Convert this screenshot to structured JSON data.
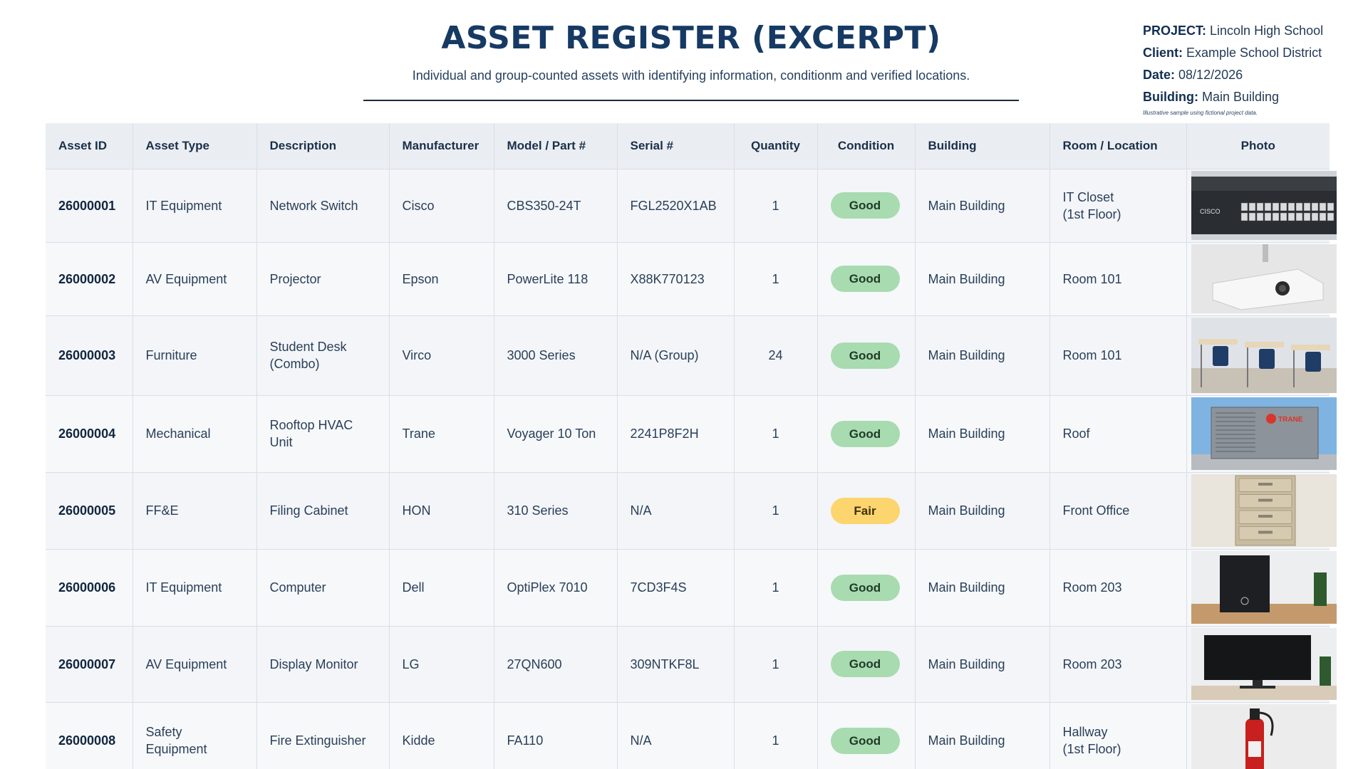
{
  "header": {
    "title": "ASSET REGISTER (EXCERPT)",
    "subtitle": "Individual and group-counted assets with identifying information, conditionm and verified locations."
  },
  "meta": {
    "project_label": "PROJECT:",
    "project": "Lincoln High School",
    "client_label": "Client:",
    "client": "Example School District",
    "date_label": "Date:",
    "date": "08/12/2026",
    "building_label": "Building:",
    "building": "Main Building",
    "note": "Illustrative sample using fictional project data."
  },
  "table": {
    "columns": [
      "Asset ID",
      "Asset Type",
      "Description",
      "Manufacturer",
      "Model / Part #",
      "Serial #",
      "Quantity",
      "Condition",
      "Building",
      "Room / Location",
      "Photo"
    ],
    "rows": [
      {
        "id": "26000001",
        "type": "IT Equipment",
        "desc": "Network Switch",
        "mfr": "Cisco",
        "model": "CBS350-24T",
        "serial": "FGL2520X1AB",
        "qty": "1",
        "cond": "Good",
        "bldg": "Main Building",
        "loc": "IT Closet\n(1st Floor)",
        "photo": "network-switch-photo",
        "logo": "CISCO"
      },
      {
        "id": "26000002",
        "type": "AV Equipment",
        "desc": "Projector",
        "mfr": "Epson",
        "model": "PowerLite 118",
        "serial": "X88K770123",
        "qty": "1",
        "cond": "Good",
        "bldg": "Main Building",
        "loc": "Room 101",
        "photo": "projector-photo"
      },
      {
        "id": "26000003",
        "type": "Furniture",
        "desc": "Student Desk\n(Combo)",
        "mfr": "Virco",
        "model": "3000 Series",
        "serial": "N/A (Group)",
        "qty": "24",
        "cond": "Good",
        "bldg": "Main Building",
        "loc": "Room 101",
        "photo": "student-desks-photo"
      },
      {
        "id": "26000004",
        "type": "Mechanical",
        "desc": "Rooftop HVAC Unit",
        "mfr": "Trane",
        "model": "Voyager 10 Ton",
        "serial": "2241P8F2H",
        "qty": "1",
        "cond": "Good",
        "bldg": "Main Building",
        "loc": "Roof",
        "photo": "hvac-unit-photo",
        "logo": "TRANE"
      },
      {
        "id": "26000005",
        "type": "FF&E",
        "desc": "Filing Cabinet",
        "mfr": "HON",
        "model": "310 Series",
        "serial": "N/A",
        "qty": "1",
        "cond": "Fair",
        "bldg": "Main Building",
        "loc": "Front Office",
        "photo": "filing-cabinet-photo"
      },
      {
        "id": "26000006",
        "type": "IT Equipment",
        "desc": "Computer",
        "mfr": "Dell",
        "model": "OptiPlex 7010",
        "serial": "7CD3F4S",
        "qty": "1",
        "cond": "Good",
        "bldg": "Main Building",
        "loc": "Room 203",
        "photo": "desktop-computer-photo"
      },
      {
        "id": "26000007",
        "type": "AV Equipment",
        "desc": "Display Monitor",
        "mfr": "LG",
        "model": "27QN600",
        "serial": "309NTKF8L",
        "qty": "1",
        "cond": "Good",
        "bldg": "Main Building",
        "loc": "Room 203",
        "photo": "display-monitor-photo"
      },
      {
        "id": "26000008",
        "type": "Safety Equipment",
        "desc": "Fire Extinguisher",
        "mfr": "Kidde",
        "model": "FA110",
        "serial": "N/A",
        "qty": "1",
        "cond": "Good",
        "bldg": "Main Building",
        "loc": "Hallway\n(1st Floor)",
        "photo": "fire-extinguisher-photo"
      }
    ]
  },
  "colors": {
    "title": "#163a63",
    "good_badge": "#a8dbb0",
    "fair_badge": "#fcd56e",
    "header_row": "#eaeef3"
  }
}
